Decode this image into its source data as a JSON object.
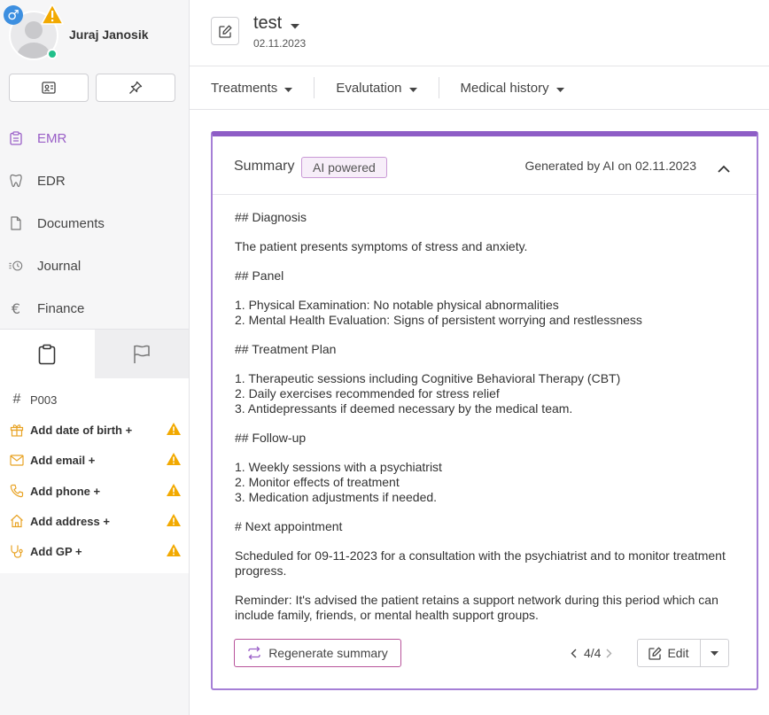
{
  "patient": {
    "name": "Juraj Janosik",
    "gender_symbol": "♂",
    "id": "P003"
  },
  "nav": [
    {
      "label": "EMR",
      "icon": "clipboard-icon",
      "active": true
    },
    {
      "label": "EDR",
      "icon": "tooth-icon",
      "active": false
    },
    {
      "label": "Documents",
      "icon": "document-icon",
      "active": false
    },
    {
      "label": "Journal",
      "icon": "history-icon",
      "active": false
    },
    {
      "label": "Finance",
      "icon": "euro-icon",
      "active": false
    }
  ],
  "info": {
    "dob": "Add date of birth +",
    "email": "Add email +",
    "phone": "Add phone +",
    "address": "Add address +",
    "gp": "Add GP +"
  },
  "header": {
    "title": "test",
    "date": "02.11.2023"
  },
  "menus": [
    "Treatments",
    "Evalutation",
    "Medical history"
  ],
  "summary": {
    "title": "Summary",
    "badge": "AI powered",
    "generated": "Generated by AI on 02.11.2023",
    "lines": [
      "## Diagnosis",
      "",
      "The patient presents symptoms of stress and anxiety.",
      "",
      "## Panel",
      "",
      "1. Physical Examination: No notable physical abnormalities",
      "2. Mental Health Evaluation: Signs of persistent worrying and restlessness",
      "",
      "## Treatment Plan",
      "",
      "1. Therapeutic sessions including Cognitive Behavioral Therapy (CBT)",
      "2. Daily exercises recommended for stress relief",
      "3. Antidepressants if deemed necessary by the medical team.",
      "",
      "## Follow-up",
      "",
      "1. Weekly sessions with a psychiatrist",
      "2. Monitor effects of treatment",
      "3. Medication adjustments if needed.",
      "",
      "# Next appointment",
      "",
      "Scheduled for 09-11-2023 for a consultation with the psychiatrist and to monitor treatment progress.",
      "",
      "Reminder: It's advised the patient retains a support network during this period which can include family, friends, or mental health support groups."
    ],
    "regenerate_label": "Regenerate summary",
    "page": "4/4",
    "edit_label": "Edit"
  },
  "colors": {
    "accent": "#8e5dc6",
    "warning": "#f2a900",
    "online": "#21c08b",
    "gender": "#3d8fe0"
  }
}
